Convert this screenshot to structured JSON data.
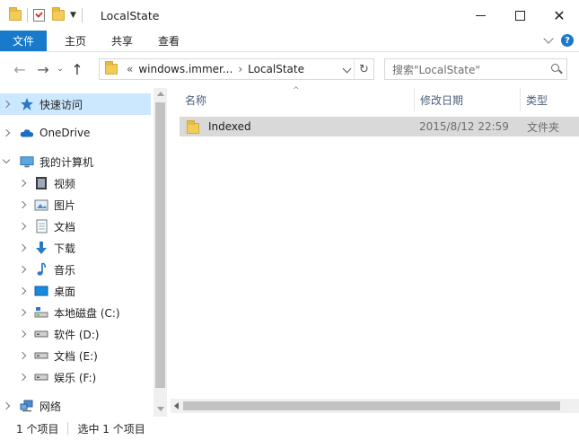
{
  "window": {
    "title": "LocalState"
  },
  "ribbon": {
    "file_tab": "文件",
    "tabs": [
      "主页",
      "共享",
      "查看"
    ],
    "help_label": "?"
  },
  "address": {
    "overflow": "«",
    "crumbs": [
      "windows.immer...",
      "LocalState"
    ],
    "separator": "›"
  },
  "search": {
    "placeholder": "搜索\"LocalState\""
  },
  "nav_pane": {
    "items": [
      {
        "label": "快速访问",
        "icon": "star-icon",
        "selected": true
      },
      {
        "label": "OneDrive",
        "icon": "cloud-icon"
      },
      {
        "label": "我的计算机",
        "icon": "computer-icon",
        "expanded": true
      },
      {
        "label": "视频",
        "icon": "video-icon"
      },
      {
        "label": "图片",
        "icon": "picture-icon"
      },
      {
        "label": "文档",
        "icon": "document-icon"
      },
      {
        "label": "下载",
        "icon": "download-icon"
      },
      {
        "label": "音乐",
        "icon": "music-icon"
      },
      {
        "label": "桌面",
        "icon": "desktop-icon"
      },
      {
        "label": "本地磁盘 (C:)",
        "icon": "system-drive-icon"
      },
      {
        "label": "软件 (D:)",
        "icon": "drive-icon"
      },
      {
        "label": "文档 (E:)",
        "icon": "drive-icon"
      },
      {
        "label": "娱乐 (F:)",
        "icon": "drive-icon"
      },
      {
        "label": "网络",
        "icon": "network-icon"
      }
    ]
  },
  "file_list": {
    "columns": [
      "名称",
      "修改日期",
      "类型"
    ],
    "rows": [
      {
        "name": "Indexed",
        "date": "2015/8/12 22:59",
        "type": "文件夹"
      }
    ]
  },
  "status_bar": {
    "item_count": "1 个项目",
    "selection": "选中 1 个项目"
  },
  "colors": {
    "accent": "#1979ca",
    "selection": "#cce8ff",
    "row_selected": "#d9d9d9",
    "folder": "#f2cc5b"
  }
}
